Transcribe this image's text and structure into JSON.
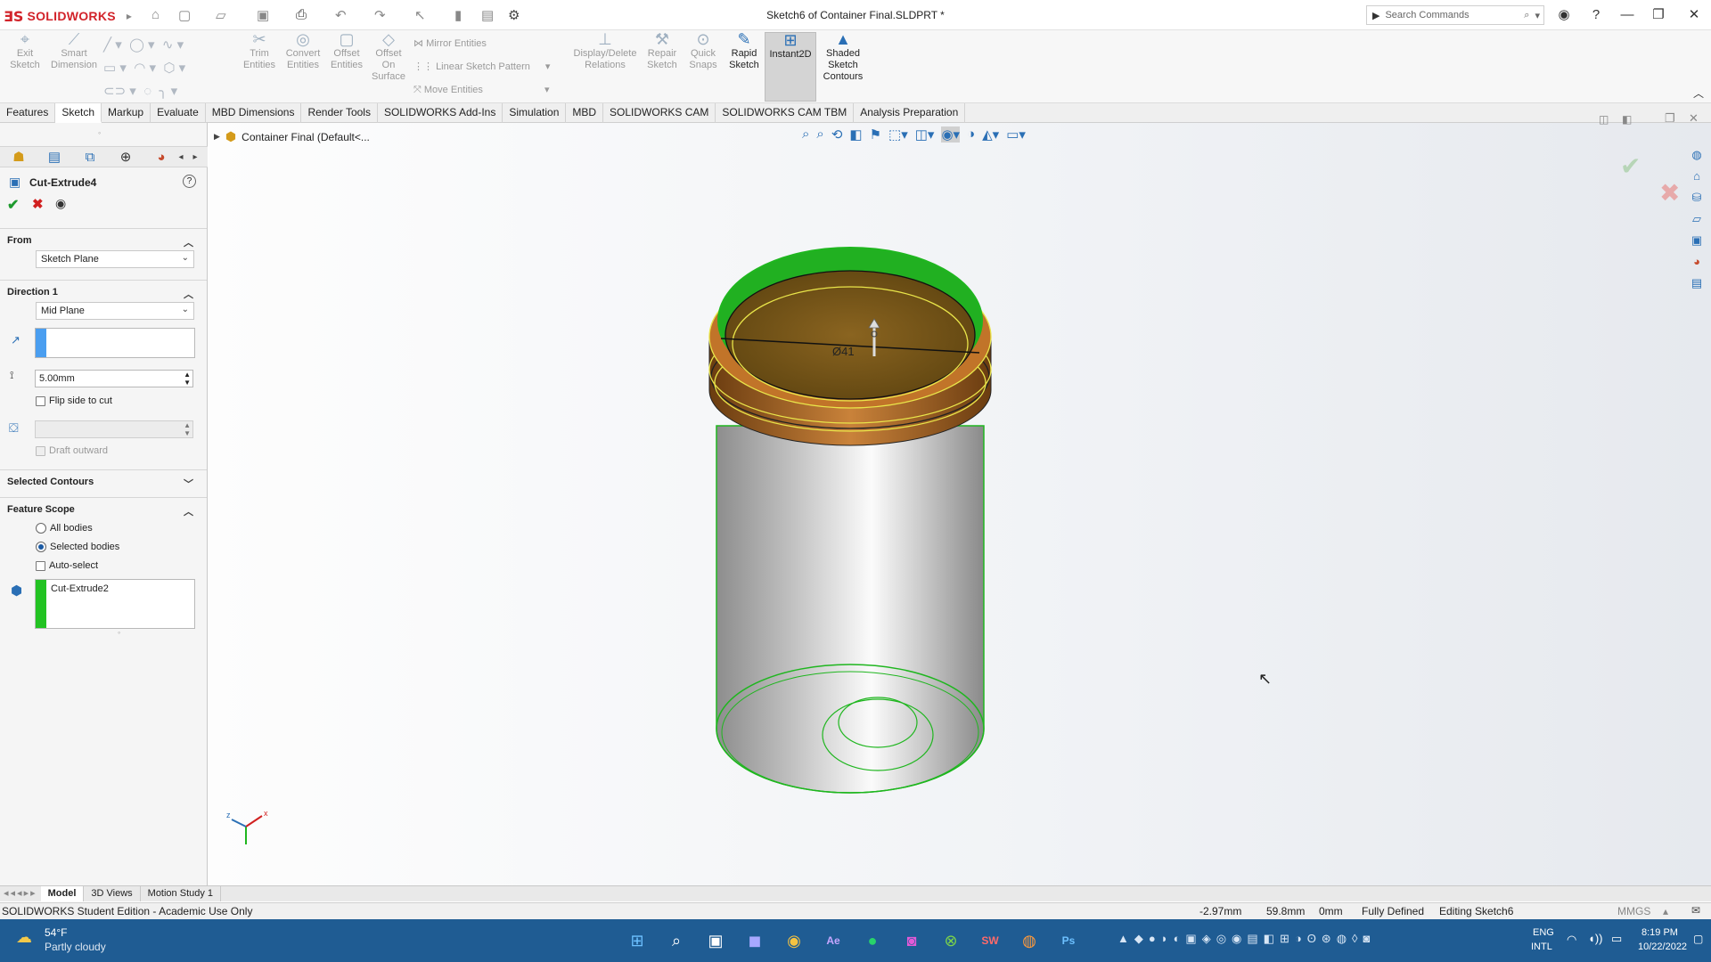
{
  "app": {
    "brand": "SOLIDWORKS",
    "document_title": "Sketch6 of Container Final.SLDPRT *"
  },
  "search": {
    "placeholder": "Search Commands"
  },
  "commands": [
    {
      "label": "Exit\nSketch",
      "enabled": false
    },
    {
      "label": "Smart\nDimension",
      "enabled": false
    },
    {
      "label": "Trim\nEntities",
      "enabled": false
    },
    {
      "label": "Convert\nEntities",
      "enabled": false
    },
    {
      "label": "Offset\nEntities",
      "enabled": false
    },
    {
      "label": "Offset\nOn\nSurface",
      "enabled": false
    },
    {
      "label": "Display/Delete\nRelations",
      "enabled": false
    },
    {
      "label": "Repair\nSketch",
      "enabled": false
    },
    {
      "label": "Quick\nSnaps",
      "enabled": false
    },
    {
      "label": "Rapid\nSketch",
      "enabled": true
    },
    {
      "label": "Instant2D",
      "enabled": true,
      "active": true
    },
    {
      "label": "Shaded\nSketch\nContours",
      "enabled": true
    }
  ],
  "small_commands": {
    "mirror": "Mirror Entities",
    "linear_pattern": "Linear Sketch Pattern",
    "move": "Move Entities"
  },
  "tabs": [
    "Features",
    "Sketch",
    "Markup",
    "Evaluate",
    "MBD Dimensions",
    "Render Tools",
    "SOLIDWORKS Add-Ins",
    "Simulation",
    "MBD",
    "SOLIDWORKS CAM",
    "SOLIDWORKS CAM TBM",
    "Analysis Preparation"
  ],
  "active_tab": "Sketch",
  "property_manager": {
    "title": "Cut-Extrude4",
    "from": {
      "heading": "From",
      "value": "Sketch Plane"
    },
    "direction1": {
      "heading": "Direction 1",
      "end_condition": "Mid Plane",
      "depth": "5.00mm",
      "flip_label": "Flip side to cut",
      "draft_label": "Draft outward"
    },
    "selected_contours": {
      "heading": "Selected Contours"
    },
    "feature_scope": {
      "heading": "Feature Scope",
      "all_bodies": "All bodies",
      "selected_bodies": "Selected bodies",
      "auto_select": "Auto-select",
      "selected_item": "Cut-Extrude2"
    }
  },
  "feature_tree": {
    "label": "Container Final  (Default<..."
  },
  "model_dimension": "Ø41",
  "model_tabs": [
    "Model",
    "3D Views",
    "Motion Study 1"
  ],
  "active_model_tab": "Model",
  "status": {
    "edition": "SOLIDWORKS Student Edition - Academic Use Only",
    "x": "-2.97mm",
    "y": "59.8mm",
    "z": "0mm",
    "state": "Fully Defined",
    "editing": "Editing Sketch6",
    "units": "MMGS"
  },
  "taskbar": {
    "temp": "54°F",
    "weather": "Partly cloudy",
    "lang1": "ENG",
    "lang2": "INTL",
    "time": "8:19 PM",
    "date": "10/22/2022"
  },
  "colors": {
    "accent": "#2a6fb5",
    "taskbar": "#1f5c93",
    "sketch_green": "#1fb61f",
    "brand_red": "#d2232a"
  }
}
